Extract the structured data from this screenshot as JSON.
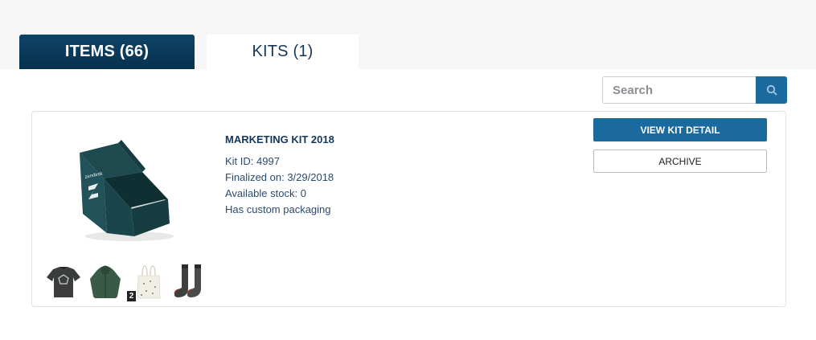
{
  "tabs": {
    "items_label": "ITEMS (66)",
    "kits_label": "KITS (1)"
  },
  "search": {
    "placeholder": "Search",
    "icon": "search-icon"
  },
  "kit": {
    "title": "MARKETING KIT 2018",
    "kit_id": "Kit ID: 4997",
    "finalized": "Finalized on: 3/29/2018",
    "stock": "Available stock: 0",
    "packaging": "Has custom packaging",
    "box_brand_text": "zendesk",
    "thumbnails": [
      {
        "name": "t-shirt"
      },
      {
        "name": "hoodie",
        "badge": "2"
      },
      {
        "name": "tote-bag"
      },
      {
        "name": "socks"
      }
    ],
    "view_button": "VIEW KIT DETAIL",
    "archive_button": "ARCHIVE"
  },
  "colors": {
    "primary": "#1a6a9f",
    "tab_active": "#0e4366",
    "text_dark": "#14385c"
  }
}
